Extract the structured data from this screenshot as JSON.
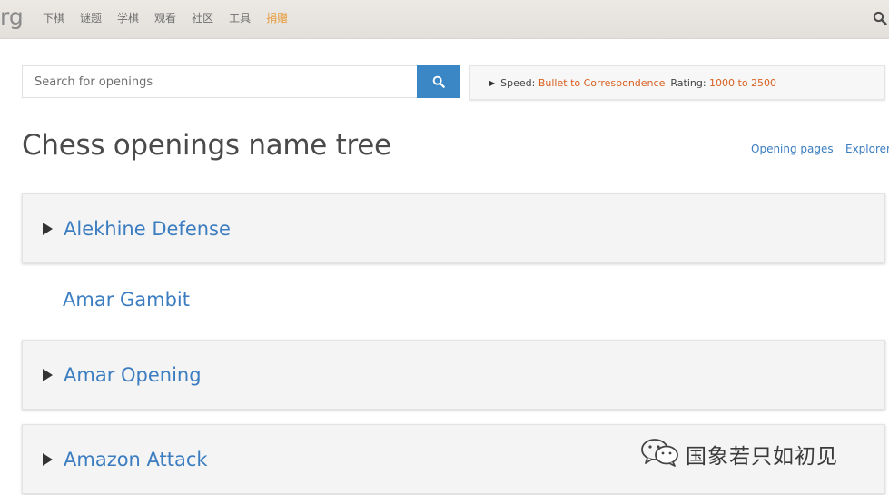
{
  "header": {
    "logo_fragment": "rg",
    "nav": [
      "下棋",
      "谜题",
      "学棋",
      "观看",
      "社区",
      "工具",
      "捐赠"
    ]
  },
  "search": {
    "placeholder": "Search for openings",
    "value": ""
  },
  "filter": {
    "speed_label": "Speed:",
    "speed_value": "Bullet to Correspondence",
    "rating_label": "Rating:",
    "rating_value": "1000 to 2500"
  },
  "page": {
    "title": "Chess openings name tree",
    "links": [
      "Opening pages",
      "Explorer"
    ]
  },
  "openings": [
    {
      "name": "Alekhine Defense",
      "expandable": true
    },
    {
      "name": "Amar Gambit",
      "expandable": false
    },
    {
      "name": "Amar Opening",
      "expandable": true
    },
    {
      "name": "Amazon Attack",
      "expandable": true
    }
  ],
  "watermark": {
    "text": "国象若只如初见",
    "icon": "wechat-icon"
  },
  "colors": {
    "link": "#3b7dc0",
    "accent_orange": "#d85f1f",
    "search_button": "#3b87c6",
    "donate": "#e69b3a"
  }
}
